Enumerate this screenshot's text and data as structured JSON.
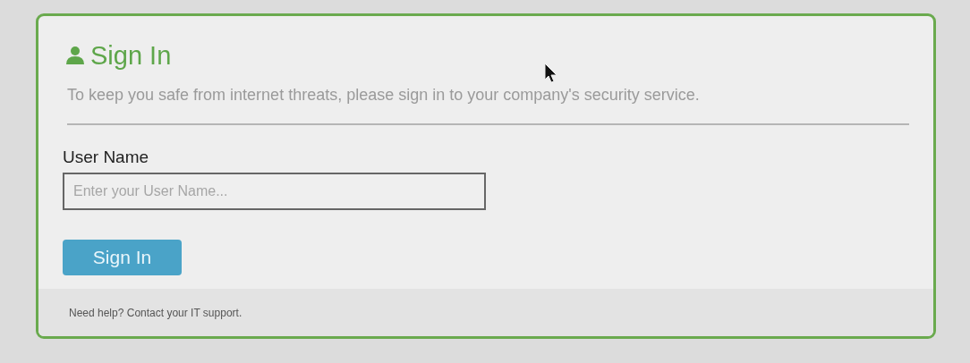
{
  "card": {
    "title": "Sign In",
    "description": "To keep you safe from internet threats, please sign in to your company's security service.",
    "field": {
      "label": "User Name",
      "placeholder": "Enter your User Name..."
    },
    "button": "Sign In",
    "footer": "Need help? Contact your IT support."
  }
}
